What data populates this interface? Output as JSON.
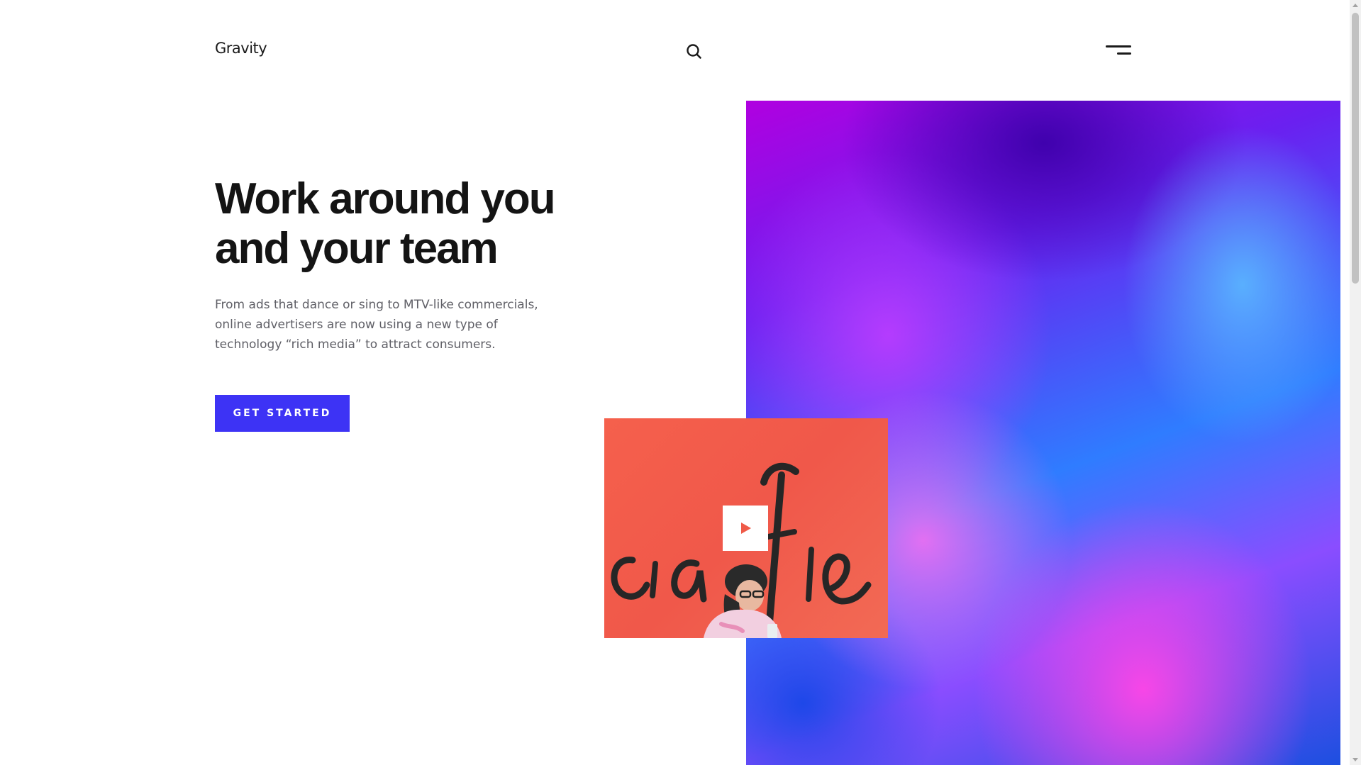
{
  "header": {
    "logo": "Gravity",
    "search_icon": "search-icon",
    "menu_icon": "hamburger-menu-icon"
  },
  "hero": {
    "title_line1": "Work around you",
    "title_line2": "and your team",
    "description": "From ads that dance or sing to MTV-like commercials, online advertisers are now using a new type of technology “rich media” to attract consumers.",
    "cta_label": "GET STARTED"
  },
  "media": {
    "play_icon": "play-icon"
  },
  "colors": {
    "accent": "#3d33f5",
    "text_dark": "#141414",
    "text_muted": "#5f5f66",
    "video_bg": "#f5604c"
  }
}
